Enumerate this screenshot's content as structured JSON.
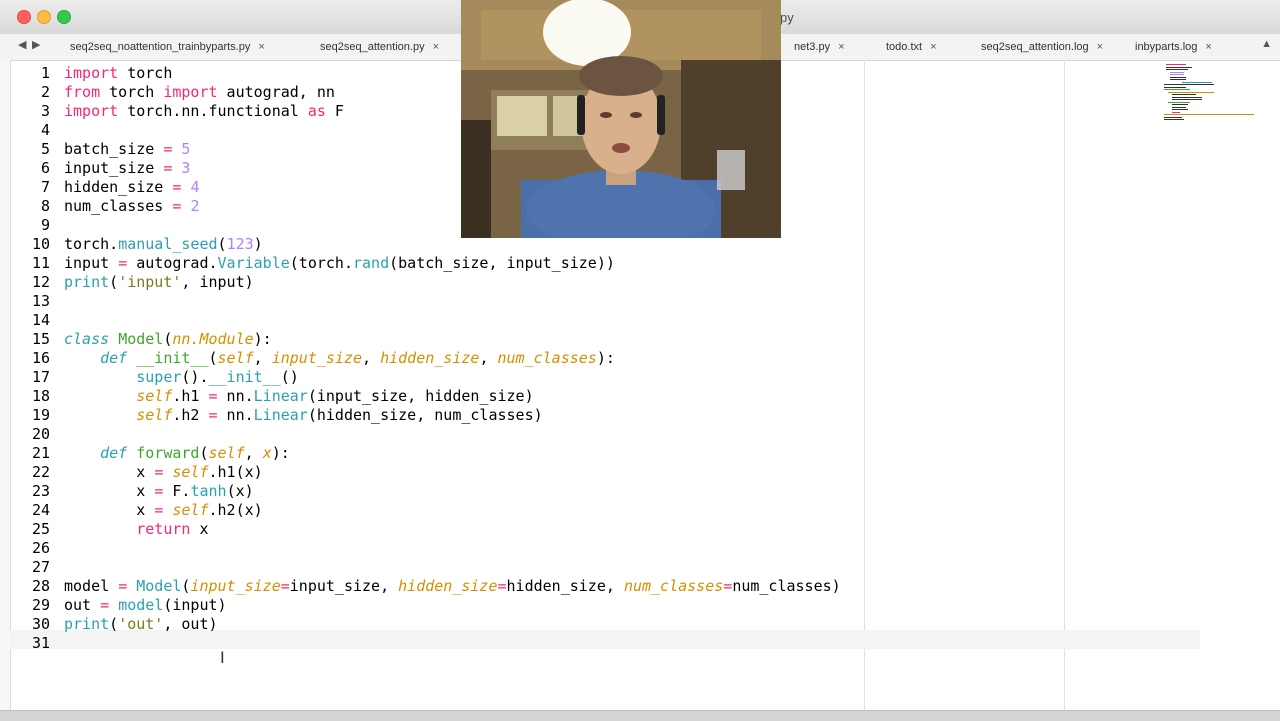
{
  "window": {
    "title": "py"
  },
  "tabs": [
    {
      "label": "seq2seq_noattention_trainbyparts.py"
    },
    {
      "label": "seq2seq_attention.py"
    },
    {
      "label": "net3.py"
    },
    {
      "label": "todo.txt"
    },
    {
      "label": "seq2seq_attention.log"
    },
    {
      "label": "inbyparts.log"
    }
  ],
  "tab_close_glyph": "×",
  "editor": {
    "line_numbers": [
      "1",
      "2",
      "3",
      "4",
      "5",
      "6",
      "7",
      "8",
      "9",
      "10",
      "11",
      "12",
      "13",
      "14",
      "15",
      "16",
      "17",
      "18",
      "19",
      "20",
      "21",
      "22",
      "23",
      "24",
      "25",
      "26",
      "27",
      "28",
      "29",
      "30",
      "31"
    ]
  },
  "colors": {
    "keyword": "#f92672",
    "function": "#2aa1b3",
    "class_name": "#3fa72a",
    "number": "#ae81ff",
    "argument": "#d78f00"
  },
  "icons": [
    "back-arrow-icon",
    "forward-arrow-icon",
    "tab-close-icon",
    "tab-overflow-icon",
    "text-cursor-icon"
  ]
}
